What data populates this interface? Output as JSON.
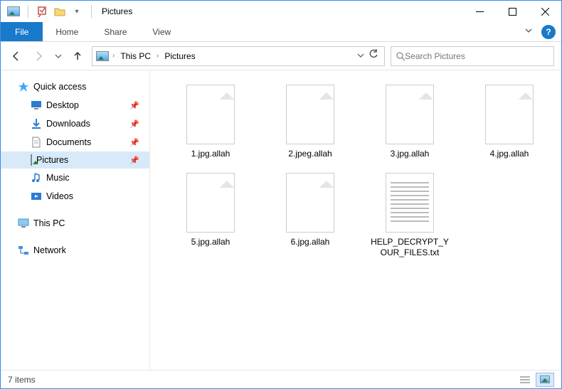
{
  "window": {
    "title": "Pictures"
  },
  "ribbon": {
    "file": "File",
    "tabs": [
      "Home",
      "Share",
      "View"
    ]
  },
  "breadcrumb": {
    "parts": [
      "This PC",
      "Pictures"
    ]
  },
  "search": {
    "placeholder": "Search Pictures"
  },
  "sidebar": {
    "quick_access": "Quick access",
    "items": [
      {
        "label": "Desktop",
        "pinned": true,
        "icon": "desktop"
      },
      {
        "label": "Downloads",
        "pinned": true,
        "icon": "downloads"
      },
      {
        "label": "Documents",
        "pinned": true,
        "icon": "documents"
      },
      {
        "label": "Pictures",
        "pinned": true,
        "icon": "pictures",
        "selected": true
      },
      {
        "label": "Music",
        "pinned": false,
        "icon": "music"
      },
      {
        "label": "Videos",
        "pinned": false,
        "icon": "videos"
      }
    ],
    "this_pc": "This PC",
    "network": "Network"
  },
  "files": [
    {
      "name": "1.jpg.allah",
      "type": "blank"
    },
    {
      "name": "2.jpeg.allah",
      "type": "blank"
    },
    {
      "name": "3.jpg.allah",
      "type": "blank"
    },
    {
      "name": "4.jpg.allah",
      "type": "blank"
    },
    {
      "name": "5.jpg.allah",
      "type": "blank"
    },
    {
      "name": "6.jpg.allah",
      "type": "blank"
    },
    {
      "name": "HELP_DECRYPT_YOUR_FILES.txt",
      "type": "txt"
    }
  ],
  "status": {
    "count_text": "7 items"
  }
}
